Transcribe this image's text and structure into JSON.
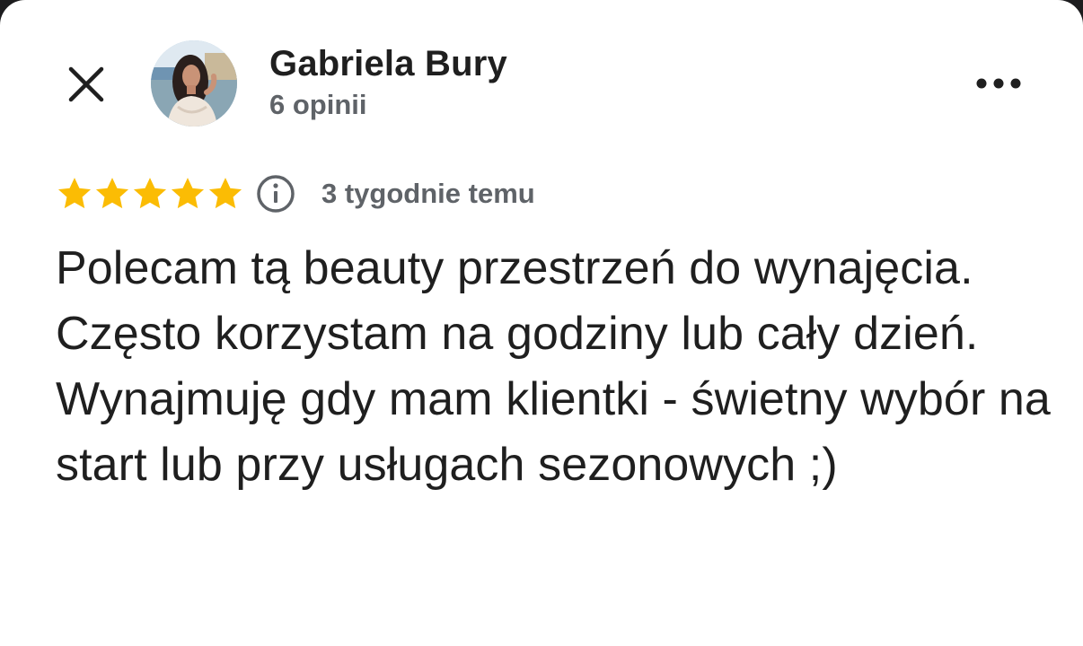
{
  "header": {
    "close_icon": "close-icon",
    "more_icon": "more-horizontal-icon"
  },
  "author": {
    "name": "Gabriela Bury",
    "reviews_count_label": "6 opinii",
    "avatar_icon": "profile-photo"
  },
  "review": {
    "rating": 5,
    "rating_max": 5,
    "star_color": "#fbbc04",
    "info_icon": "info-icon",
    "date": "3 tygodnie temu",
    "text": "Polecam tą beauty przestrzeń do wynajęcia. Często korzystam na godziny lub cały dzień. Wynajmuję gdy mam klientki - świetny wybór na start lub przy usługach sezonowych ;)"
  }
}
